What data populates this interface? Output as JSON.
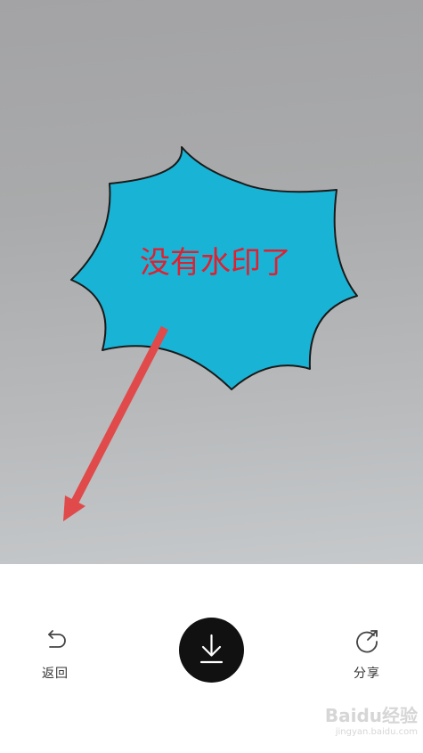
{
  "photo": {
    "bubble_text": "没有水印了",
    "bubble_fill": "#19b3d6",
    "bubble_text_color": "#e02030",
    "arrow_color": "#e04a4a"
  },
  "toolbar": {
    "back_label": "返回",
    "share_label": "分享",
    "back_icon": "undo-arrow-icon",
    "download_icon": "download-icon",
    "share_icon": "share-rotate-icon"
  },
  "watermark": {
    "brand": "Baidu经验",
    "url": "jingyan.baidu.com"
  }
}
